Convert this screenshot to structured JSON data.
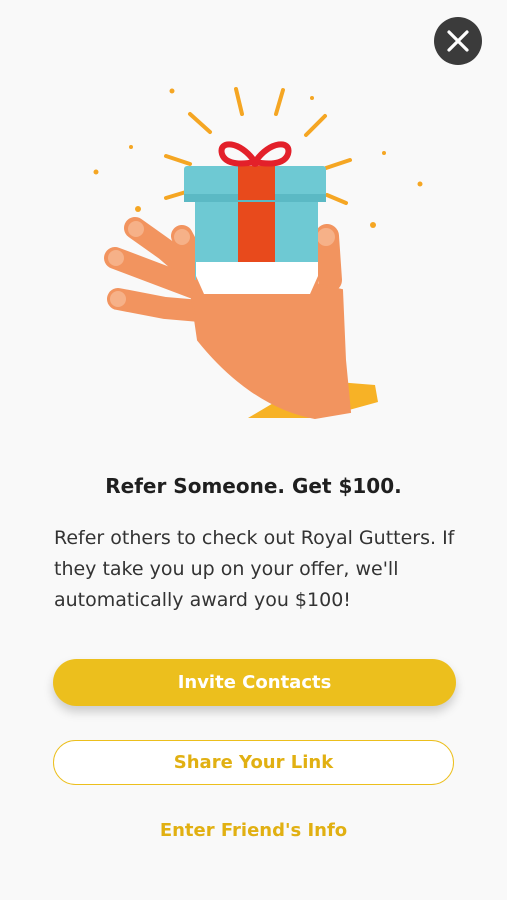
{
  "modal": {
    "close_icon": "close-icon",
    "illustration_icon": "hand-gift-icon",
    "headline": "Refer Someone. Get $100.",
    "body": "Refer others to check out Royal Gutters. If they take you up on your offer, we'll automatically award you $100!",
    "invite_label": "Invite Contacts",
    "share_label": "Share Your Link",
    "enter_label": "Enter Friend's Info"
  },
  "colors": {
    "accent": "#ecbf1d",
    "accent_text": "#e1b012",
    "background": "#f9f9f9",
    "close_bg": "#3b3b3b"
  }
}
